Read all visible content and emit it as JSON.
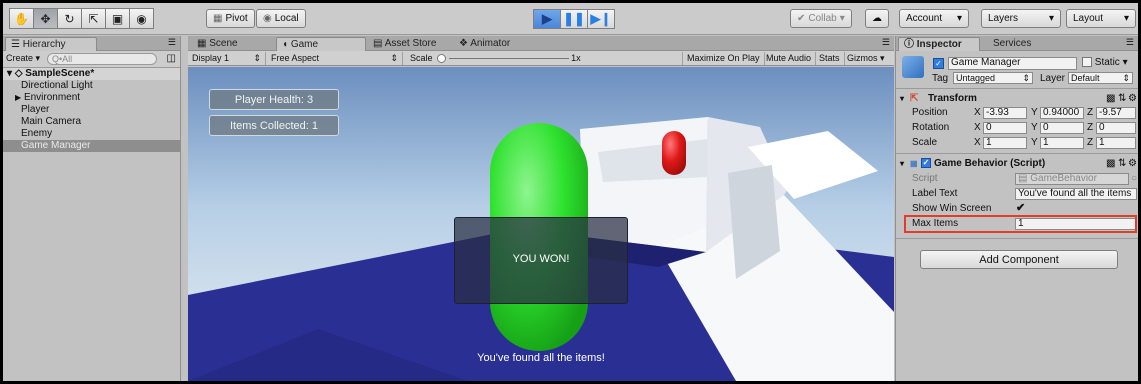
{
  "toolbar": {
    "pivot_label": "Pivot",
    "local_label": "Local",
    "collab_label": "Collab",
    "account_label": "Account",
    "layers_label": "Layers",
    "layout_label": "Layout"
  },
  "hierarchy": {
    "tab_label": "Hierarchy",
    "create_label": "Create",
    "search_placeholder": "Q•All",
    "scene_name": "SampleScene*",
    "items": [
      "Directional Light",
      "Environment",
      "Player",
      "Main Camera",
      "Enemy",
      "Game Manager"
    ],
    "selected_item": "Game Manager"
  },
  "center": {
    "tabs": [
      "Scene",
      "Game",
      "Asset Store",
      "Animator"
    ],
    "active_tab": "Game",
    "display_label": "Display 1",
    "aspect_label": "Free Aspect",
    "scale_label": "Scale",
    "scale_value": "1x",
    "maximize_label": "Maximize On Play",
    "mute_label": "Mute Audio",
    "stats_label": "Stats",
    "gizmos_label": "Gizmos"
  },
  "game_ui": {
    "player_health": "Player Health: 3",
    "items_collected": "Items Collected: 1",
    "win_text": "YOU WON!",
    "found_text": "You've found all the items!"
  },
  "inspector": {
    "tabs": [
      "Inspector",
      "Services"
    ],
    "object_name": "Game Manager",
    "static_label": "Static",
    "tag_label": "Tag",
    "tag_value": "Untagged",
    "layer_label": "Layer",
    "layer_value": "Default",
    "transform": {
      "title": "Transform",
      "position_label": "Position",
      "rotation_label": "Rotation",
      "scale_label": "Scale",
      "position": {
        "x": "-3.93",
        "y": "0.94000",
        "z": "-9.57"
      },
      "rotation": {
        "x": "0",
        "y": "0",
        "z": "0"
      },
      "scale": {
        "x": "1",
        "y": "1",
        "z": "1"
      }
    },
    "behavior": {
      "title": "Game Behavior (Script)",
      "script_label": "Script",
      "script_value": "GameBehavior",
      "label_text_label": "Label Text",
      "label_text_value": "You've found all the items",
      "show_win_label": "Show Win Screen",
      "max_items_label": "Max Items",
      "max_items_value": "1"
    },
    "add_component_label": "Add Component"
  },
  "colors": {
    "highlight": "#e23d2a",
    "capsule_green": "#2ee12e",
    "enemy_red": "#e01818",
    "floor_blue": "#2a2f94",
    "play_blue": "#2a7ee6"
  }
}
